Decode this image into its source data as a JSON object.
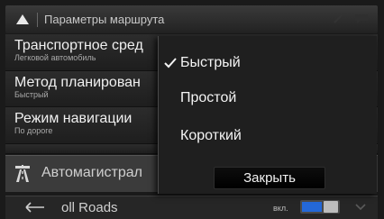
{
  "header": {
    "title": "Параметры маршрута",
    "icons": [
      "back-triangle-icon",
      "device-icon",
      "chat-bubble-icon"
    ]
  },
  "settings": [
    {
      "label": "Транспортное сред",
      "value": "Легковой автомобиль"
    },
    {
      "label": "Метод планирован",
      "value": "Быстрый"
    },
    {
      "label": "Режим навигации",
      "value": "По дороге"
    }
  ],
  "section": {
    "label": "Автомагистрал",
    "icon": "highway-icon"
  },
  "toll_roads": {
    "label": "oll Roads",
    "toggle_label": "вкл.",
    "enabled": true
  },
  "popup": {
    "options": [
      {
        "label": "Быстрый",
        "selected": true
      },
      {
        "label": "Простой",
        "selected": false
      },
      {
        "label": "Короткий",
        "selected": false
      }
    ],
    "close_label": "Закрыть"
  },
  "colors": {
    "accent": "#2468d8"
  }
}
